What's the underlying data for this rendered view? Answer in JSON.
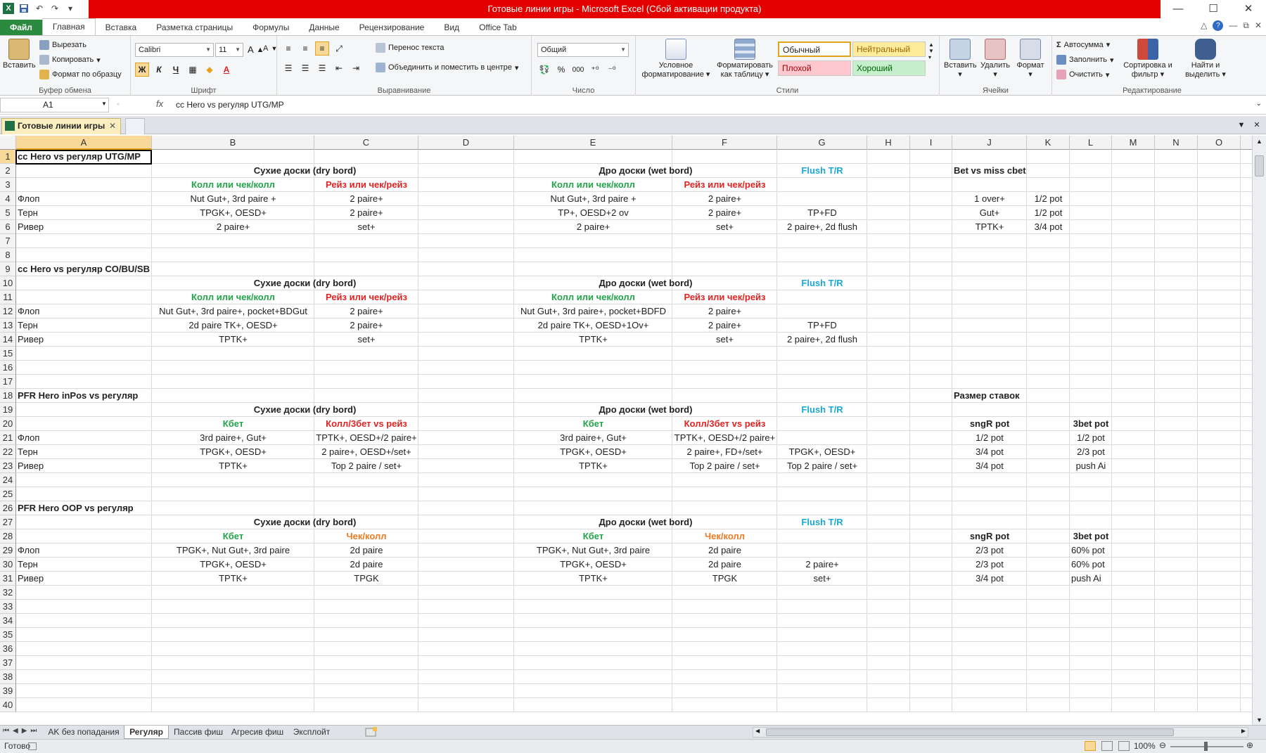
{
  "window": {
    "title": "Готовые линии игры  -  Microsoft Excel (Сбой активации продукта)",
    "logo": "X"
  },
  "qat": {
    "save_icon": "save-icon",
    "undo_icon": "undo-icon",
    "redo_icon": "redo-icon"
  },
  "window_controls": {
    "minimize": "—",
    "maximize": "☐",
    "close": "✕"
  },
  "ribbon_tabs": [
    "Файл",
    "Главная",
    "Вставка",
    "Разметка страницы",
    "Формулы",
    "Данные",
    "Рецензирование",
    "Вид",
    "Office Tab"
  ],
  "ribbon_right": {
    "help": "?",
    "min": "—",
    "restore": "⧉",
    "close": "✕"
  },
  "clipboard": {
    "paste": "Вставить",
    "cut": "Вырезать",
    "copy": "Копировать",
    "format_painter": "Формат по образцу",
    "label": "Буфер обмена"
  },
  "font": {
    "name": "Calibri",
    "size": "11",
    "bold": "Ж",
    "italic": "К",
    "underline": "Ч",
    "label": "Шрифт"
  },
  "alignment": {
    "wrap": "Перенос текста",
    "merge": "Объединить и поместить в центре",
    "label": "Выравнивание"
  },
  "number": {
    "format": "Общий",
    "percent": "%",
    "thousands": "000",
    "label": "Число"
  },
  "styles": {
    "conditional": "Условное форматирование",
    "as_table": "Форматировать как таблицу",
    "normal": "Обычный",
    "neutral": "Нейтральный",
    "bad": "Плохой",
    "good": "Хороший",
    "label": "Стили"
  },
  "cells": {
    "insert": "Вставить",
    "delete": "Удалить",
    "format": "Формат",
    "label": "Ячейки"
  },
  "editing": {
    "autosum": "Автосумма",
    "fill": "Заполнить",
    "clear": "Очистить",
    "sort": "Сортировка и фильтр",
    "find": "Найти и выделить",
    "label": "Редактирование"
  },
  "formula_bar": {
    "name_box": "A1",
    "fx": "fx",
    "formula": "cc Hero vs регуляр UTG/MP"
  },
  "doc_tab": {
    "name": "Готовые линии игры",
    "close": "✕"
  },
  "columns": [
    "A",
    "B",
    "C",
    "D",
    "E",
    "F",
    "G",
    "H",
    "I",
    "J",
    "K",
    "L",
    "M",
    "N",
    "O"
  ],
  "rows": [
    {
      "n": "1",
      "cells": [
        {
          "col": "A",
          "text": "cc Hero vs регуляр UTG/MP",
          "style": "l b"
        }
      ]
    },
    {
      "n": "2",
      "cells": [
        {
          "col": "B",
          "text": "Сухие доски (dry bord)",
          "style": "b span-bc"
        },
        {
          "col": "E",
          "text": "Дро доски (wet bord)",
          "style": "b span-ef"
        },
        {
          "col": "G",
          "text": "Flush T/R",
          "style": "c b blue"
        },
        {
          "col": "J",
          "text": "Bet vs miss cbet",
          "style": "l b"
        }
      ]
    },
    {
      "n": "3",
      "cells": [
        {
          "col": "B",
          "text": "Колл или чек/колл",
          "style": "c b green"
        },
        {
          "col": "C",
          "text": "Рейз или чек/рейз",
          "style": "c b red"
        },
        {
          "col": "E",
          "text": "Колл или чек/колл",
          "style": "c b green"
        },
        {
          "col": "F",
          "text": "Рейз или чек/рейз",
          "style": "c b red"
        }
      ]
    },
    {
      "n": "4",
      "cells": [
        {
          "col": "A",
          "text": "Флоп",
          "style": "l"
        },
        {
          "col": "B",
          "text": "Nut Gut+, 3rd paire +",
          "style": "c"
        },
        {
          "col": "C",
          "text": "2 paire+",
          "style": "c"
        },
        {
          "col": "E",
          "text": "Nut Gut+, 3rd paire +",
          "style": "c"
        },
        {
          "col": "F",
          "text": "2 paire+",
          "style": "c"
        },
        {
          "col": "J",
          "text": "1 over+",
          "style": "c"
        },
        {
          "col": "K",
          "text": "1/2 pot",
          "style": "c"
        }
      ]
    },
    {
      "n": "5",
      "cells": [
        {
          "col": "A",
          "text": "Терн",
          "style": "l"
        },
        {
          "col": "B",
          "text": "TPGK+, OESD+",
          "style": "c"
        },
        {
          "col": "C",
          "text": "2 paire+",
          "style": "c"
        },
        {
          "col": "E",
          "text": "TP+, OESD+2 ov",
          "style": "c"
        },
        {
          "col": "F",
          "text": "2 paire+",
          "style": "c"
        },
        {
          "col": "G",
          "text": "TP+FD",
          "style": "c"
        },
        {
          "col": "J",
          "text": "Gut+",
          "style": "c"
        },
        {
          "col": "K",
          "text": "1/2 pot",
          "style": "c"
        }
      ]
    },
    {
      "n": "6",
      "cells": [
        {
          "col": "A",
          "text": "Ривер",
          "style": "l"
        },
        {
          "col": "B",
          "text": "2 paire+",
          "style": "c"
        },
        {
          "col": "C",
          "text": "set+",
          "style": "c"
        },
        {
          "col": "E",
          "text": "2 paire+",
          "style": "c"
        },
        {
          "col": "F",
          "text": "set+",
          "style": "c"
        },
        {
          "col": "G",
          "text": "2 paire+, 2d flush",
          "style": "c"
        },
        {
          "col": "J",
          "text": "TPTK+",
          "style": "c"
        },
        {
          "col": "K",
          "text": "3/4 pot",
          "style": "c"
        }
      ]
    },
    {
      "n": "7",
      "cells": []
    },
    {
      "n": "8",
      "cells": []
    },
    {
      "n": "9",
      "cells": [
        {
          "col": "A",
          "text": "cc Hero vs регуляр CO/BU/SB",
          "style": "l b"
        }
      ]
    },
    {
      "n": "10",
      "cells": [
        {
          "col": "B",
          "text": "Сухие доски (dry bord)",
          "style": "b span-bc"
        },
        {
          "col": "E",
          "text": "Дро доски (wet bord)",
          "style": "b span-ef"
        },
        {
          "col": "G",
          "text": "Flush T/R",
          "style": "c b blue"
        }
      ]
    },
    {
      "n": "11",
      "cells": [
        {
          "col": "B",
          "text": "Колл или чек/колл",
          "style": "c b green"
        },
        {
          "col": "C",
          "text": "Рейз или чек/рейз",
          "style": "c b red"
        },
        {
          "col": "E",
          "text": "Колл или чек/колл",
          "style": "c b green"
        },
        {
          "col": "F",
          "text": "Рейз или чек/рейз",
          "style": "c b red"
        }
      ]
    },
    {
      "n": "12",
      "cells": [
        {
          "col": "A",
          "text": "Флоп",
          "style": "l"
        },
        {
          "col": "B",
          "text": "Nut Gut+, 3rd paire+, pocket+BDGut",
          "style": "c"
        },
        {
          "col": "C",
          "text": "2 paire+",
          "style": "c"
        },
        {
          "col": "E",
          "text": "Nut Gut+, 3rd paire+, pocket+BDFD",
          "style": "c"
        },
        {
          "col": "F",
          "text": "2 paire+",
          "style": "c"
        }
      ]
    },
    {
      "n": "13",
      "cells": [
        {
          "col": "A",
          "text": "Терн",
          "style": "l"
        },
        {
          "col": "B",
          "text": "2d paire TK+, OESD+",
          "style": "c"
        },
        {
          "col": "C",
          "text": "2 paire+",
          "style": "c"
        },
        {
          "col": "E",
          "text": "2d paire TK+, OESD+1Ov+",
          "style": "c"
        },
        {
          "col": "F",
          "text": "2 paire+",
          "style": "c"
        },
        {
          "col": "G",
          "text": "TP+FD",
          "style": "c"
        }
      ]
    },
    {
      "n": "14",
      "cells": [
        {
          "col": "A",
          "text": "Ривер",
          "style": "l"
        },
        {
          "col": "B",
          "text": "TPTK+",
          "style": "c"
        },
        {
          "col": "C",
          "text": "set+",
          "style": "c"
        },
        {
          "col": "E",
          "text": "TPTK+",
          "style": "c"
        },
        {
          "col": "F",
          "text": "set+",
          "style": "c"
        },
        {
          "col": "G",
          "text": "2 paire+, 2d flush",
          "style": "c"
        }
      ]
    },
    {
      "n": "15",
      "cells": []
    },
    {
      "n": "16",
      "cells": []
    },
    {
      "n": "17",
      "cells": []
    },
    {
      "n": "18",
      "cells": [
        {
          "col": "A",
          "text": "PFR Hero inPos vs регуляр",
          "style": "l b"
        },
        {
          "col": "J",
          "text": "Размер ставок",
          "style": "l b"
        }
      ]
    },
    {
      "n": "19",
      "cells": [
        {
          "col": "B",
          "text": "Сухие доски (dry bord)",
          "style": "b span-bc"
        },
        {
          "col": "E",
          "text": "Дро доски (wet bord)",
          "style": "b span-ef"
        },
        {
          "col": "G",
          "text": "Flush T/R",
          "style": "c b blue"
        }
      ]
    },
    {
      "n": "20",
      "cells": [
        {
          "col": "B",
          "text": "Кбет",
          "style": "c b green"
        },
        {
          "col": "C",
          "text": "Колл/3бет vs рейз",
          "style": "c b red"
        },
        {
          "col": "E",
          "text": "Кбет",
          "style": "c b green"
        },
        {
          "col": "F",
          "text": "Колл/3бет vs рейз",
          "style": "c b red"
        },
        {
          "col": "J",
          "text": "sngR pot",
          "style": "c b"
        },
        {
          "col": "L",
          "text": "3bet pot",
          "style": "c b"
        }
      ]
    },
    {
      "n": "21",
      "cells": [
        {
          "col": "A",
          "text": "Флоп",
          "style": "l"
        },
        {
          "col": "B",
          "text": "3rd paire+, Gut+",
          "style": "c"
        },
        {
          "col": "C",
          "text": "TPTK+, OESD+/2 paire+",
          "style": "c"
        },
        {
          "col": "E",
          "text": "3rd paire+, Gut+",
          "style": "c"
        },
        {
          "col": "F",
          "text": "TPTK+, OESD+/2 paire+",
          "style": "c"
        },
        {
          "col": "J",
          "text": "1/2 pot",
          "style": "c"
        },
        {
          "col": "L",
          "text": "1/2 pot",
          "style": "c"
        }
      ]
    },
    {
      "n": "22",
      "cells": [
        {
          "col": "A",
          "text": "Терн",
          "style": "l"
        },
        {
          "col": "B",
          "text": "TPGK+, OESD+",
          "style": "c"
        },
        {
          "col": "C",
          "text": "2 paire+, OESD+/set+",
          "style": "c"
        },
        {
          "col": "E",
          "text": "TPGK+, OESD+",
          "style": "c"
        },
        {
          "col": "F",
          "text": "2 paire+, FD+/set+",
          "style": "c"
        },
        {
          "col": "G",
          "text": "TPGK+, OESD+",
          "style": "c"
        },
        {
          "col": "J",
          "text": "3/4 pot",
          "style": "c"
        },
        {
          "col": "L",
          "text": "2/3 pot",
          "style": "c"
        }
      ]
    },
    {
      "n": "23",
      "cells": [
        {
          "col": "A",
          "text": "Ривер",
          "style": "l"
        },
        {
          "col": "B",
          "text": "TPTK+",
          "style": "c"
        },
        {
          "col": "C",
          "text": "Top 2 paire / set+",
          "style": "c"
        },
        {
          "col": "E",
          "text": "TPTK+",
          "style": "c"
        },
        {
          "col": "F",
          "text": "Top 2 paire / set+",
          "style": "c"
        },
        {
          "col": "G",
          "text": "Top 2 paire / set+",
          "style": "c"
        },
        {
          "col": "J",
          "text": "3/4 pot",
          "style": "c"
        },
        {
          "col": "L",
          "text": "push Ai",
          "style": "c"
        }
      ]
    },
    {
      "n": "24",
      "cells": []
    },
    {
      "n": "25",
      "cells": []
    },
    {
      "n": "26",
      "cells": [
        {
          "col": "A",
          "text": "PFR Hero OOP vs регуляр",
          "style": "l b"
        }
      ]
    },
    {
      "n": "27",
      "cells": [
        {
          "col": "B",
          "text": "Сухие доски (dry bord)",
          "style": "b span-bc"
        },
        {
          "col": "E",
          "text": "Дро доски (wet bord)",
          "style": "b span-ef"
        },
        {
          "col": "G",
          "text": "Flush T/R",
          "style": "c b blue"
        }
      ]
    },
    {
      "n": "28",
      "cells": [
        {
          "col": "B",
          "text": "Кбет",
          "style": "c b green"
        },
        {
          "col": "C",
          "text": "Чек/колл",
          "style": "c b orange"
        },
        {
          "col": "E",
          "text": "Кбет",
          "style": "c b green"
        },
        {
          "col": "F",
          "text": "Чек/колл",
          "style": "c b orange"
        },
        {
          "col": "J",
          "text": "sngR pot",
          "style": "c b"
        },
        {
          "col": "L",
          "text": "3bet pot",
          "style": "c b"
        }
      ]
    },
    {
      "n": "29",
      "cells": [
        {
          "col": "A",
          "text": "Флоп",
          "style": "l"
        },
        {
          "col": "B",
          "text": "TPGK+, Nut Gut+, 3rd paire",
          "style": "c"
        },
        {
          "col": "C",
          "text": "2d paire",
          "style": "c"
        },
        {
          "col": "E",
          "text": "TPGK+, Nut Gut+, 3rd paire",
          "style": "c"
        },
        {
          "col": "F",
          "text": "2d paire",
          "style": "c"
        },
        {
          "col": "J",
          "text": "2/3 pot",
          "style": "c"
        },
        {
          "col": "L",
          "text": "60% pot",
          "style": "l"
        }
      ]
    },
    {
      "n": "30",
      "cells": [
        {
          "col": "A",
          "text": "Терн",
          "style": "l"
        },
        {
          "col": "B",
          "text": "TPGK+, OESD+",
          "style": "c"
        },
        {
          "col": "C",
          "text": "2d paire",
          "style": "c"
        },
        {
          "col": "E",
          "text": "TPGK+, OESD+",
          "style": "c"
        },
        {
          "col": "F",
          "text": "2d paire",
          "style": "c"
        },
        {
          "col": "G",
          "text": "2 paire+",
          "style": "c"
        },
        {
          "col": "J",
          "text": "2/3 pot",
          "style": "c"
        },
        {
          "col": "L",
          "text": "60% pot",
          "style": "l"
        }
      ]
    },
    {
      "n": "31",
      "cells": [
        {
          "col": "A",
          "text": "Ривер",
          "style": "l"
        },
        {
          "col": "B",
          "text": "TPTK+",
          "style": "c"
        },
        {
          "col": "C",
          "text": "TPGK",
          "style": "c"
        },
        {
          "col": "E",
          "text": "TPTK+",
          "style": "c"
        },
        {
          "col": "F",
          "text": "TPGK",
          "style": "c"
        },
        {
          "col": "G",
          "text": "set+",
          "style": "c"
        },
        {
          "col": "J",
          "text": "3/4 pot",
          "style": "c"
        },
        {
          "col": "L",
          "text": "push Ai",
          "style": "l"
        }
      ]
    },
    {
      "n": "32",
      "cells": []
    },
    {
      "n": "33",
      "cells": []
    },
    {
      "n": "34",
      "cells": []
    },
    {
      "n": "35",
      "cells": []
    },
    {
      "n": "36",
      "cells": []
    },
    {
      "n": "37",
      "cells": []
    },
    {
      "n": "38",
      "cells": []
    },
    {
      "n": "39",
      "cells": []
    },
    {
      "n": "40",
      "cells": []
    }
  ],
  "sheet_tabs": [
    {
      "name": "AK без попадания",
      "active": false
    },
    {
      "name": "Регуляр",
      "active": true
    },
    {
      "name": "Пассив фиш",
      "active": false
    },
    {
      "name": "Агресив фиш",
      "active": false
    },
    {
      "name": "Эксплойт",
      "active": false
    }
  ],
  "status": {
    "ready": "Готово",
    "zoom": "100%"
  }
}
